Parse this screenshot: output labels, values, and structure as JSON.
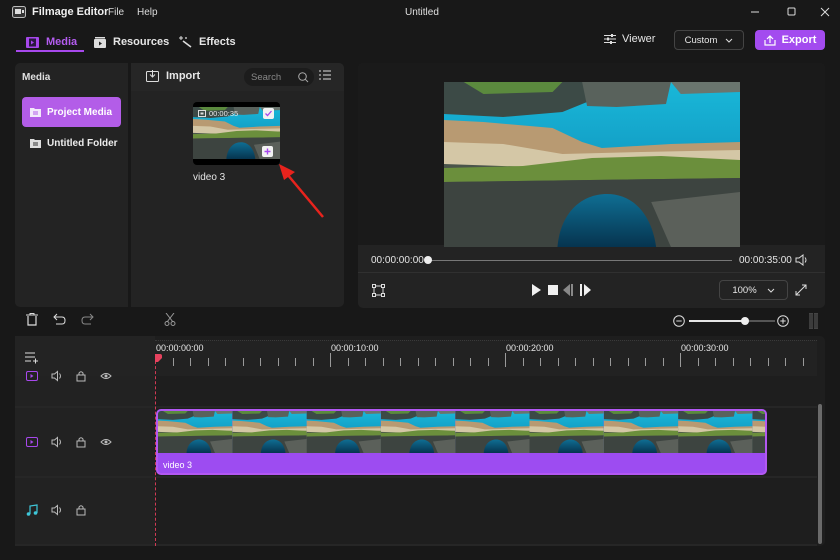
{
  "app": {
    "name": "Filmage Editor",
    "window_title": "Untitled",
    "menus": [
      "File",
      "Help"
    ]
  },
  "nav": {
    "tabs": [
      {
        "label": "Media",
        "icon": "media-film-icon",
        "active": true
      },
      {
        "label": "Resources",
        "icon": "resources-icon",
        "active": false
      },
      {
        "label": "Effects",
        "icon": "magic-wand-icon",
        "active": false
      }
    ],
    "viewer_label": "Viewer",
    "preset_select": "Custom",
    "export_label": "Export"
  },
  "media_panel": {
    "title": "Media",
    "folders": [
      {
        "label": "Project Media",
        "active": true
      },
      {
        "label": "Untitled Folder",
        "active": false
      }
    ],
    "import_label": "Import",
    "search_placeholder": "Search",
    "items": [
      {
        "name": "video 3",
        "duration": "00:00:35",
        "selected": true
      }
    ]
  },
  "preview": {
    "current_time": "00:00:00:00",
    "total_time": "00:00:35:00",
    "progress": 0,
    "zoom": "100%"
  },
  "timeline": {
    "ruler_labels": [
      "00:00:00:00",
      "00:00:10:00",
      "00:00:20:00",
      "00:00:30:00"
    ],
    "zoom_level": 0.65,
    "tracks": [
      {
        "type": "video",
        "partial": true
      },
      {
        "type": "video",
        "clips": [
          {
            "label": "video 3"
          }
        ]
      },
      {
        "type": "audio"
      }
    ]
  },
  "colors": {
    "accent": "#a34bef",
    "playhead": "#e6425e",
    "annotation_arrow": "#e8231d",
    "audio_track": "#3ec6d8"
  }
}
